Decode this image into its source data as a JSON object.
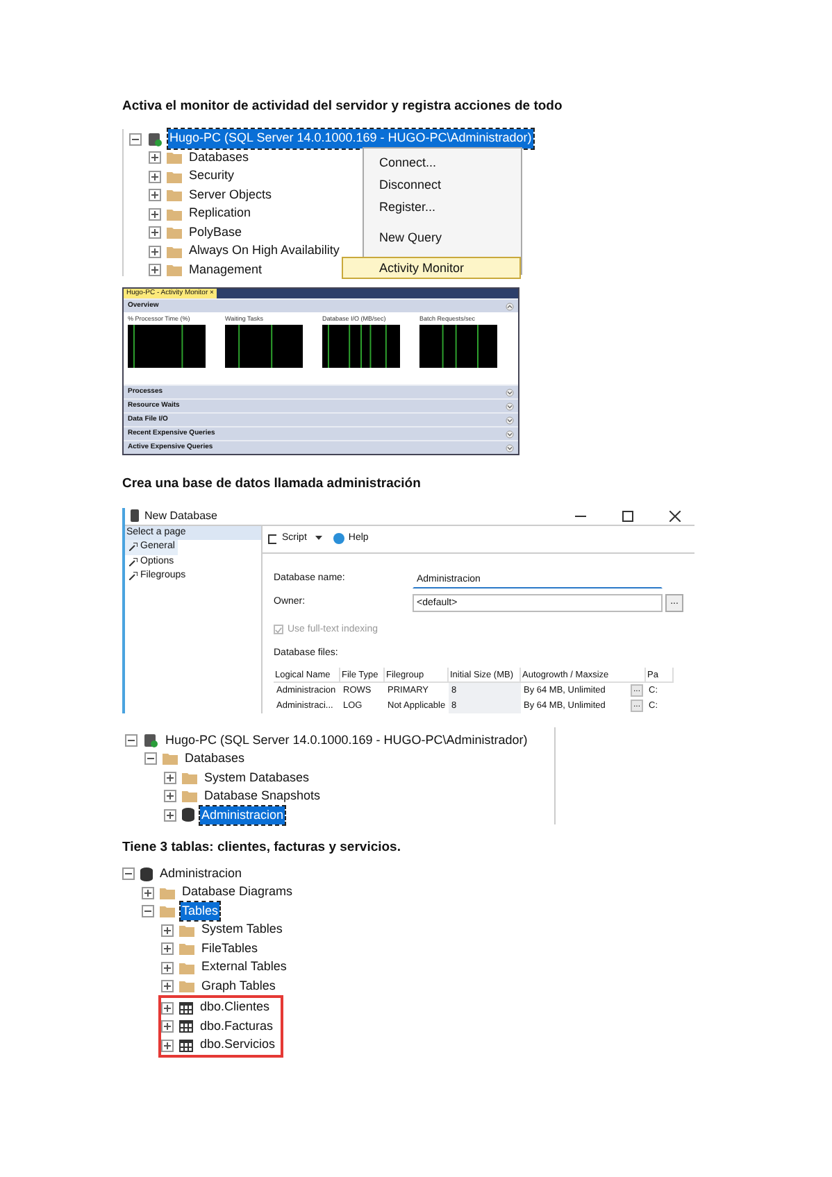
{
  "heading_1": "Activa el monitor de actividad del servidor y registra acciones de todo",
  "explorer_1": {
    "nodes": [
      {
        "kind": "server",
        "label": "Hugo-PC (SQL Server 14.0.1000.169 - HUGO-PC\\Administrador)",
        "expanded": true,
        "selected": true,
        "children": [
          {
            "kind": "folder",
            "label": "Databases",
            "expanded": false,
            "selected": false
          },
          {
            "kind": "folder",
            "label": "Security",
            "expanded": false,
            "selected": false
          },
          {
            "kind": "folder",
            "label": "Server Objects",
            "expanded": false,
            "selected": false
          },
          {
            "kind": "folder",
            "label": "Replication",
            "expanded": false,
            "selected": false
          },
          {
            "kind": "folder",
            "label": "PolyBase",
            "expanded": false,
            "selected": false
          },
          {
            "kind": "folder",
            "label": "Always On High Availability",
            "expanded": false,
            "selected": false
          },
          {
            "kind": "folder",
            "label": "Management",
            "expanded": false,
            "selected": false
          }
        ]
      }
    ]
  },
  "context_menu": {
    "items": [
      {
        "kind": "item",
        "label": "Connect...",
        "selected": false
      },
      {
        "kind": "item",
        "label": "Disconnect",
        "selected": false
      },
      {
        "kind": "item",
        "label": "Register...",
        "selected": false
      },
      {
        "kind": "separator"
      },
      {
        "kind": "item",
        "label": "New Query",
        "selected": false
      },
      {
        "kind": "separator"
      },
      {
        "kind": "item",
        "label": "Activity Monitor",
        "selected": true
      }
    ]
  },
  "activity_monitor": {
    "tab": {
      "label": "Hugo-PC - Activity Monitor",
      "close": "×"
    },
    "sections": [
      {
        "label": "Overview",
        "expanded": true,
        "charts": [
          {
            "title": "% Processor Time (%)"
          },
          {
            "title": "Waiting Tasks"
          },
          {
            "title": "Database I/O (MB/sec)"
          },
          {
            "title": "Batch Requests/sec"
          }
        ]
      },
      {
        "label": "Processes",
        "expanded": false
      },
      {
        "label": "Resource Waits",
        "expanded": false
      },
      {
        "label": "Data File I/O",
        "expanded": false
      },
      {
        "label": "Recent Expensive Queries",
        "expanded": false
      },
      {
        "label": "Active Expensive Queries",
        "expanded": false
      }
    ]
  },
  "heading_2": "Crea una base de datos llamada administración",
  "new_database": {
    "title": "New Database",
    "pages_header": "Select a page",
    "pages": [
      {
        "label": "General",
        "selected": true
      },
      {
        "label": "Options",
        "selected": false
      },
      {
        "label": "Filegroups",
        "selected": false
      }
    ],
    "toolbar": [
      {
        "kind": "script",
        "label": "Script"
      },
      {
        "kind": "help",
        "label": "Help"
      }
    ],
    "fields": [
      {
        "label": "Database name:",
        "value": "Administracion",
        "kind": "text"
      },
      {
        "label": "Owner:",
        "value": "<default>",
        "kind": "browse",
        "button": "..."
      }
    ],
    "fulltext": {
      "label": "Use full-text indexing",
      "checked": true,
      "disabled": true
    },
    "files_label": "Database files:",
    "columns": [
      "Logical Name",
      "File Type",
      "Filegroup",
      "Initial Size (MB)",
      "Autogrowth / Maxsize",
      "Pa"
    ],
    "rows": [
      [
        "Administracion",
        "ROWS",
        "PRIMARY",
        "8",
        "By 64 MB, Unlimited",
        "C:"
      ],
      [
        "Administraci...",
        "LOG",
        "Not Applicable",
        "8",
        "By 64 MB, Unlimited",
        "C:"
      ]
    ],
    "row_button": "..."
  },
  "explorer_2": {
    "nodes": [
      {
        "kind": "server",
        "label": "Hugo-PC (SQL Server 14.0.1000.169 - HUGO-PC\\Administrador)",
        "expanded": true,
        "selected": false,
        "children": [
          {
            "kind": "folder",
            "label": "Databases",
            "expanded": true,
            "selected": false,
            "children": [
              {
                "kind": "folder",
                "label": "System Databases",
                "expanded": false,
                "selected": false
              },
              {
                "kind": "folder",
                "label": "Database Snapshots",
                "expanded": false,
                "selected": false
              },
              {
                "kind": "database",
                "label": "Administracion",
                "expanded": false,
                "selected": true
              }
            ]
          }
        ]
      }
    ]
  },
  "heading_3": "Tiene 3 tablas: clientes, facturas y servicios.",
  "explorer_3": {
    "nodes": [
      {
        "kind": "database",
        "label": "Administracion",
        "expanded": true,
        "selected": false,
        "children": [
          {
            "kind": "folder",
            "label": "Database Diagrams",
            "expanded": false,
            "selected": false
          },
          {
            "kind": "folder",
            "label": "Tables",
            "expanded": true,
            "selected": true,
            "children": [
              {
                "kind": "folder",
                "label": "System Tables",
                "expanded": false,
                "selected": false
              },
              {
                "kind": "folder",
                "label": "FileTables",
                "expanded": false,
                "selected": false
              },
              {
                "kind": "folder",
                "label": "External Tables",
                "expanded": false,
                "selected": false
              },
              {
                "kind": "folder",
                "label": "Graph Tables",
                "expanded": false,
                "selected": false
              }
            ],
            "highlighted_children": [
              {
                "kind": "table",
                "label": "dbo.Clientes",
                "expanded": false,
                "selected": false
              },
              {
                "kind": "table",
                "label": "dbo.Facturas",
                "expanded": false,
                "selected": false
              },
              {
                "kind": "table",
                "label": "dbo.Servicios",
                "expanded": false,
                "selected": false
              }
            ]
          }
        ]
      }
    ]
  }
}
